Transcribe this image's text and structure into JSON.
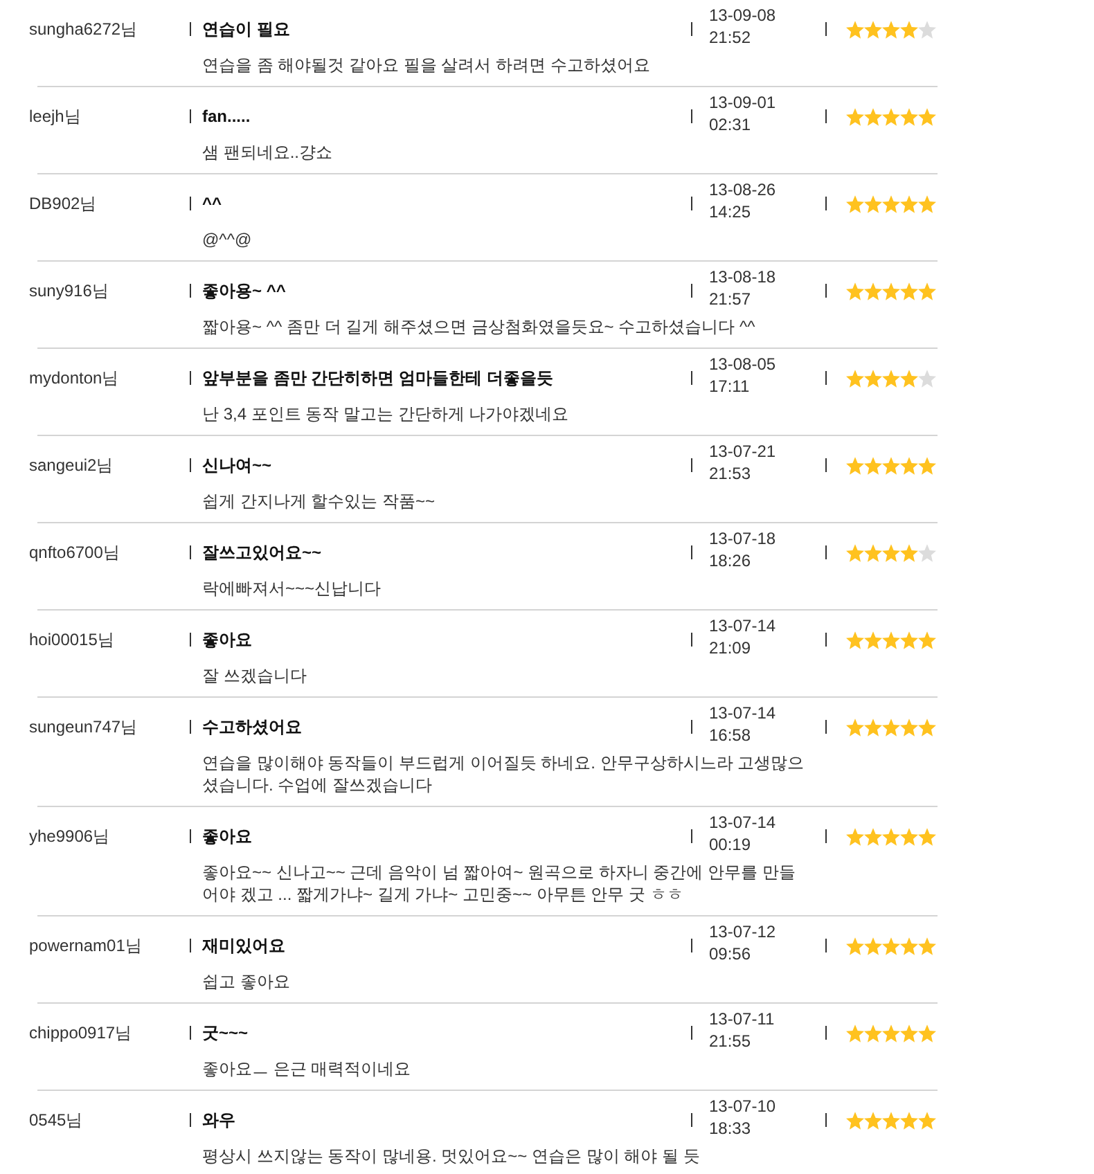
{
  "reviews": [
    {
      "user": "sungha6272님",
      "title": "연습이 필요",
      "date": "13-09-08",
      "time": "21:52",
      "stars": 4,
      "comment": "연습을 좀 해야될것 같아요 필을 살려서 하려면 수고하셨어요"
    },
    {
      "user": "leejh님",
      "title": "fan.....",
      "date": "13-09-01",
      "time": "02:31",
      "stars": 5,
      "comment": "샘 팬되네요..걍쇼"
    },
    {
      "user": "DB902님",
      "title": "^^",
      "date": "13-08-26",
      "time": "14:25",
      "stars": 5,
      "comment": "@^^@"
    },
    {
      "user": "suny916님",
      "title": "좋아용~ ^^",
      "date": "13-08-18",
      "time": "21:57",
      "stars": 5,
      "comment": "짧아용~ ^^ 좀만 더 길게 해주셨으면 금상첨화였을듯요~ 수고하셨습니다 ^^"
    },
    {
      "user": "mydonton님",
      "title": "앞부분을 좀만 간단히하면 엄마들한테 더좋을듯",
      "date": "13-08-05",
      "time": "17:11",
      "stars": 4,
      "comment": "난 3,4 포인트 동작 말고는 간단하게 나가야겠네요"
    },
    {
      "user": "sangeui2님",
      "title": "신나여~~",
      "date": "13-07-21",
      "time": "21:53",
      "stars": 5,
      "comment": "쉽게 간지나게 할수있는 작품~~"
    },
    {
      "user": "qnfto6700님",
      "title": "잘쓰고있어요~~",
      "date": "13-07-18",
      "time": "18:26",
      "stars": 4,
      "comment": "락에빠져서~~~신납니다"
    },
    {
      "user": "hoi00015님",
      "title": "좋아요",
      "date": "13-07-14",
      "time": "21:09",
      "stars": 5,
      "comment": "잘 쓰겠습니다"
    },
    {
      "user": "sungeun747님",
      "title": "수고하셨어요",
      "date": "13-07-14",
      "time": "16:58",
      "stars": 5,
      "comment": "연습을 많이해야 동작들이 부드럽게 이어질듯 하네요. 안무구상하시느라 고생많으셨습니다. 수업에 잘쓰겠습니다"
    },
    {
      "user": "yhe9906님",
      "title": "좋아요",
      "date": "13-07-14",
      "time": "00:19",
      "stars": 5,
      "comment": "좋아요~~ 신나고~~ 근데 음악이 넘 짧아여~ 원곡으로 하자니 중간에 안무를 만들어야 겠고 ... 짧게가냐~ 길게 가냐~ 고민중~~ 아무튼 안무 굿 ㅎㅎ"
    },
    {
      "user": "powernam01님",
      "title": "재미있어요",
      "date": "13-07-12",
      "time": "09:56",
      "stars": 5,
      "comment": "쉽고 좋아요"
    },
    {
      "user": "chippo0917님",
      "title": "굿~~~",
      "date": "13-07-11",
      "time": "21:55",
      "stars": 5,
      "comment": "좋아요ㅡ 은근 매력적이네요"
    },
    {
      "user": "0545님",
      "title": "와우",
      "date": "13-07-10",
      "time": "18:33",
      "stars": 5,
      "comment": "평상시 쓰지않는 동작이 많네용. 멋있어요~~ 연습은 많이 해야 될 듯"
    }
  ]
}
